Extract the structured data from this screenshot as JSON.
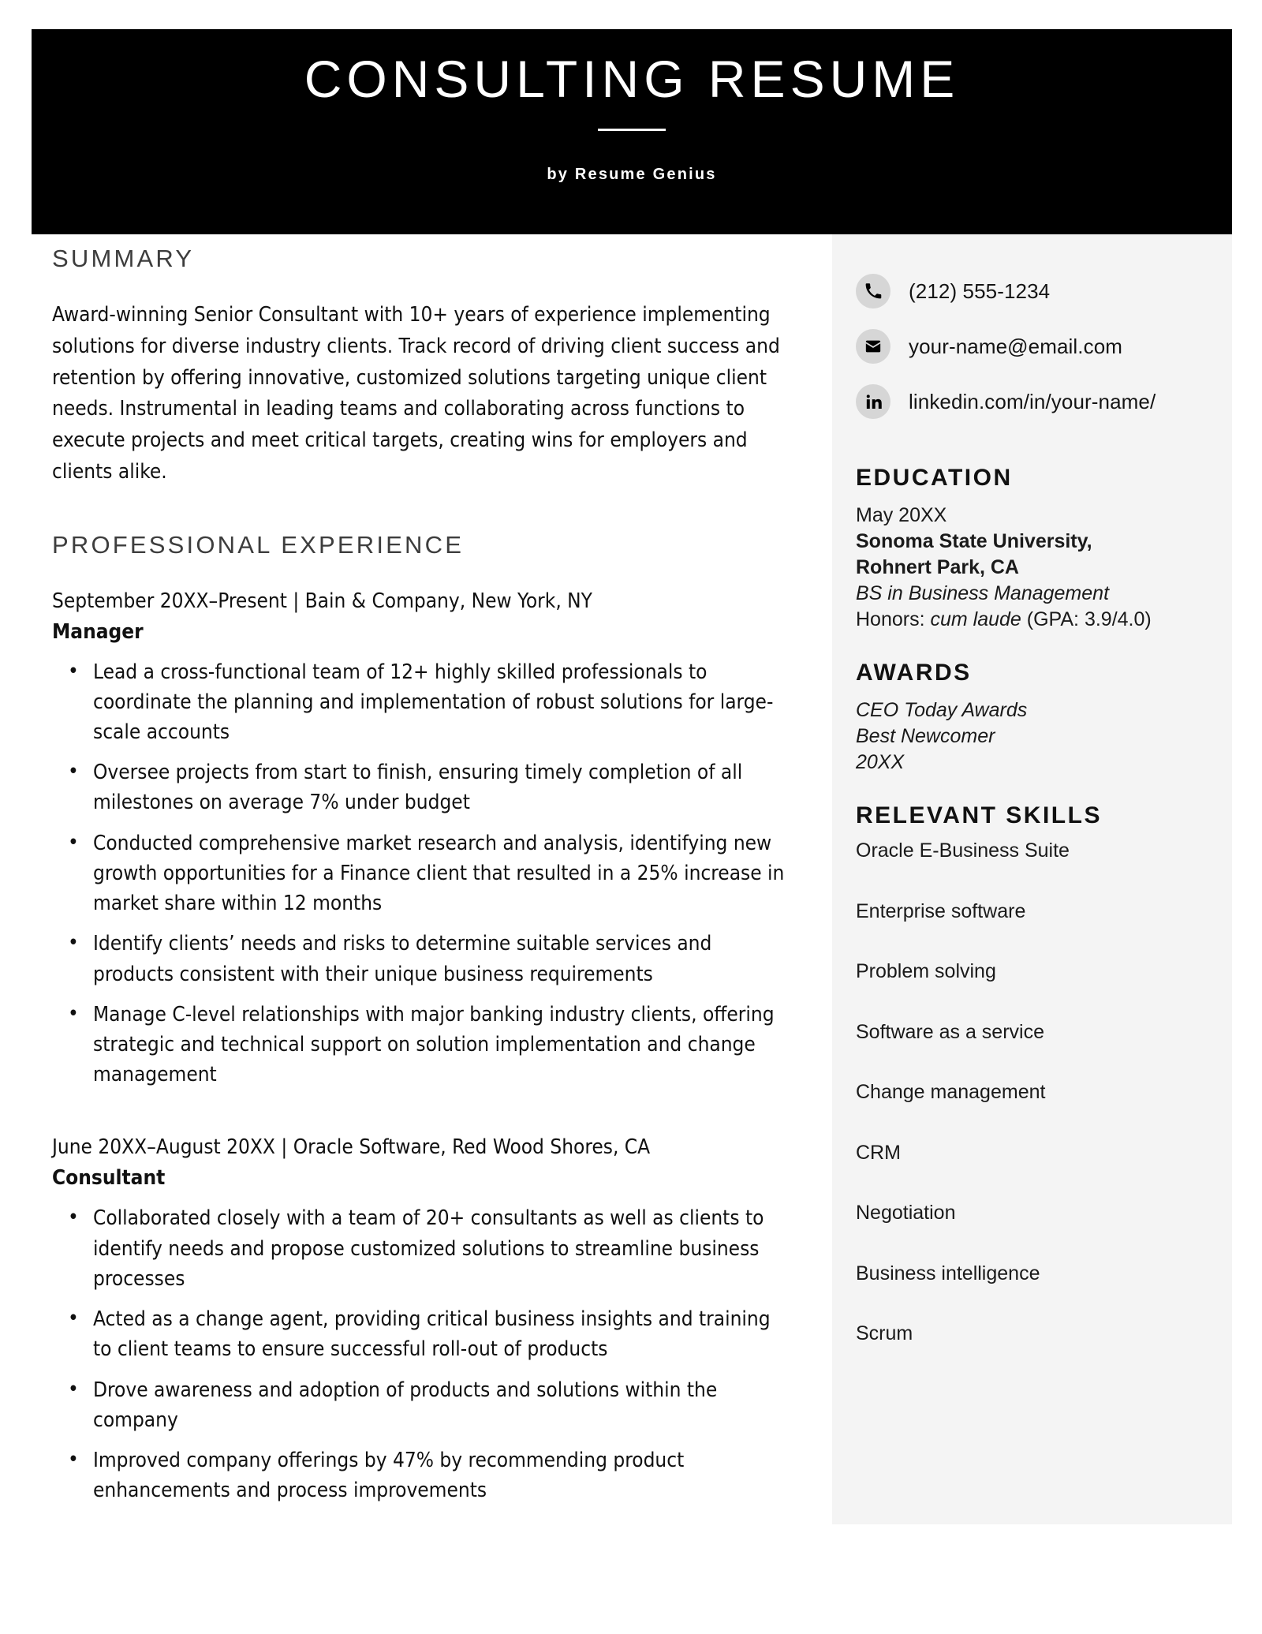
{
  "header": {
    "title": "CONSULTING RESUME",
    "byline": "by Resume Genius"
  },
  "main": {
    "summary_heading": "SUMMARY",
    "summary_text": "Award-winning Senior Consultant with 10+ years of experience implementing solutions for diverse industry clients. Track record of driving client success and retention by offering innovative, customized solutions targeting unique client needs. Instrumental in leading teams and collaborating across functions to execute projects and meet critical targets, creating wins for employers and clients alike.",
    "experience_heading": "PROFESSIONAL EXPERIENCE",
    "jobs": [
      {
        "meta": "September 20XX–Present | Bain & Company, New York, NY",
        "title": "Manager",
        "bullets": [
          "Lead a cross-functional team of 12+ highly skilled professionals to coordinate the planning and implementation of robust solutions for large-scale accounts",
          "Oversee projects from start to finish, ensuring timely completion of all milestones on average 7% under budget",
          "Conducted comprehensive market research and analysis, identifying new growth opportunities for a Finance client that resulted in a 25% increase in market share within 12 months",
          "Identify clients’ needs and risks to determine suitable services and products consistent with their unique business requirements",
          "Manage C-level relationships with major banking industry clients, offering strategic and technical support on solution implementation and change management"
        ]
      },
      {
        "meta": "June 20XX–August 20XX | Oracle Software, Red Wood Shores, CA",
        "title": "Consultant",
        "bullets": [
          "Collaborated closely with a team of 20+ consultants as well as clients to identify needs and propose customized solutions to streamline business processes",
          "Acted as a change agent, providing critical business insights and training to client teams to ensure successful roll-out of products",
          "Drove awareness and adoption of products and solutions within the company",
          "Improved company offerings by 47% by recommending product enhancements and process improvements"
        ]
      }
    ]
  },
  "sidebar": {
    "contacts": [
      {
        "icon": "phone-icon",
        "value": "(212) 555-1234"
      },
      {
        "icon": "envelope-icon",
        "value": "your-name@email.com"
      },
      {
        "icon": "linkedin-icon",
        "value": "linkedin.com/in/your-name/"
      }
    ],
    "education": {
      "heading": "EDUCATION",
      "date": "May 20XX",
      "school_line1": "Sonoma State University,",
      "school_line2": "Rohnert Park, CA",
      "degree": "BS in Business Management",
      "honors_label": "Honors: ",
      "honors_italic": "cum laude",
      "honors_rest": " (GPA: 3.9/4.0)"
    },
    "awards": {
      "heading": "AWARDS",
      "line1": "CEO Today Awards",
      "line2": "Best Newcomer",
      "line3": "20XX"
    },
    "skills": {
      "heading": "RELEVANT SKILLS",
      "items": [
        "Oracle E-Business Suite",
        "Enterprise software",
        "Problem solving",
        "Software as a service",
        "Change management",
        "CRM",
        "Negotiation",
        "Business intelligence",
        "Scrum"
      ]
    }
  },
  "colors": {
    "header_bg": "#000000",
    "sidebar_bg": "#f4f4f4",
    "icon_circle": "#d6d6d6",
    "heading_gray": "#3d3d3d",
    "body_text": "#111111"
  }
}
